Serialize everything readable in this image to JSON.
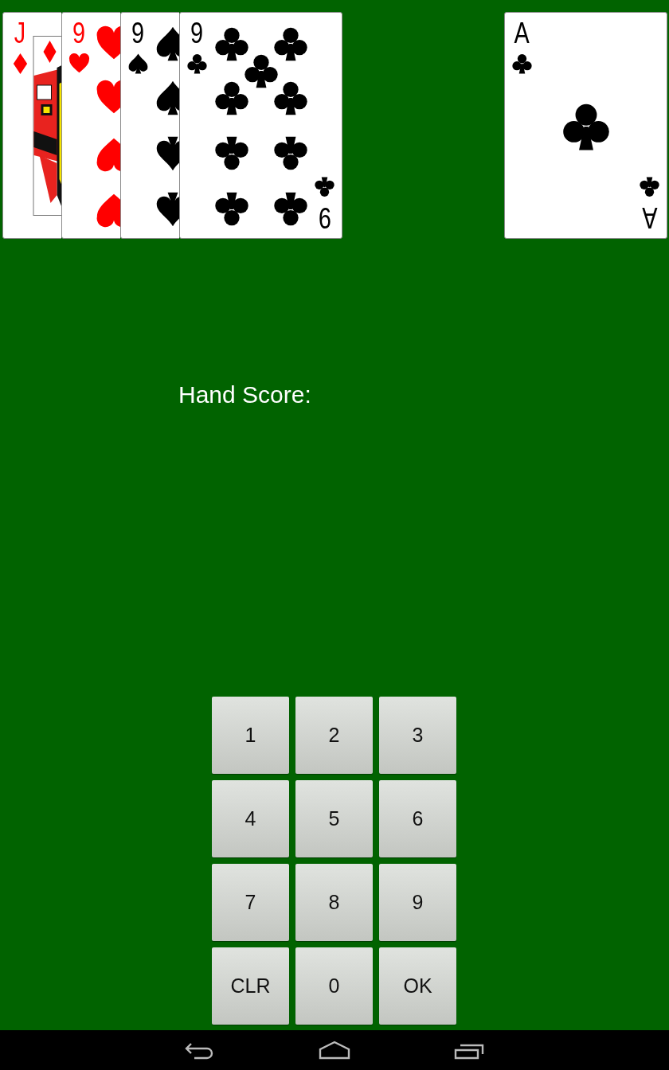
{
  "hand": [
    {
      "rank": "J",
      "suit": {
        "kind": "diamonds"
      },
      "kind": "face"
    },
    {
      "rank": "9",
      "suit": {
        "kind": "hearts"
      },
      "kind": "nine"
    },
    {
      "rank": "9",
      "suit": {
        "kind": "spades"
      },
      "kind": "nine"
    },
    {
      "rank": "9",
      "bottom_rank": "9",
      "suit": {
        "kind": "clubs"
      },
      "kind": "nine"
    }
  ],
  "starter": {
    "rank": "A",
    "bottom_rank": "A",
    "suit": {
      "kind": "clubs"
    },
    "kind": "ace"
  },
  "score_label": "Hand Score:",
  "keypad": [
    "1",
    "2",
    "3",
    "4",
    "5",
    "6",
    "7",
    "8",
    "9",
    "CLR",
    "0",
    "OK"
  ]
}
